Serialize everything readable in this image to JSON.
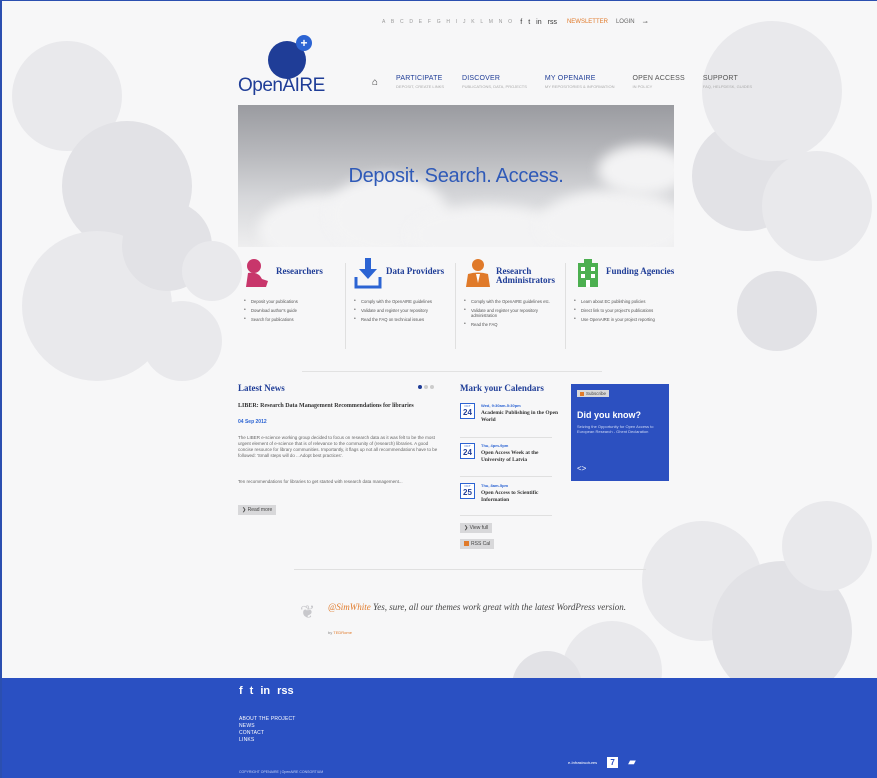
{
  "topbar": {
    "alphabet": "A B C D E F G H I J K L M N O",
    "social": [
      "f",
      "t",
      "in",
      "rss"
    ],
    "newsletter": "NEWSLETTER",
    "login": "LOGIN"
  },
  "logo": {
    "text": "OpenAIRE"
  },
  "nav": {
    "items": [
      {
        "label": "PARTICIPATE",
        "sub": "DEPOSIT, CREATE LINKS"
      },
      {
        "label": "DISCOVER",
        "sub": "PUBLICATIONS, DATA, PROJECTS"
      },
      {
        "label": "MY OPENAIRE",
        "sub": "MY REPOSITORIES & INFORMATION"
      },
      {
        "label": "OPEN ACCESS",
        "sub": "IN POLICY"
      },
      {
        "label": "SUPPORT",
        "sub": "FAQ, HELPDESK, GUIDES"
      }
    ]
  },
  "hero": {
    "title": "Deposit. Search. Access."
  },
  "audiences": [
    {
      "title": "Researchers",
      "color": "#c8366b",
      "items": [
        "Deposit your publications",
        "Download author's guide",
        "Search for publications"
      ]
    },
    {
      "title": "Data Providers",
      "color": "#2c64d3",
      "items": [
        "Comply with the OpenAIRE guidelines",
        "Validate and register your repository",
        "Read the FAQ on technical issues"
      ]
    },
    {
      "title": "Research Administrators",
      "color": "#e07a2a",
      "items": [
        "Comply with the OpenAIRE guidelines etc.",
        "Validate and register your repository administration",
        "Read the FAQ"
      ]
    },
    {
      "title": "Funding Agencies",
      "color": "#4caf50",
      "items": [
        "Learn about EC publishing policies",
        "Direct link to your project's publications",
        "Use OpenAIRE in your project reporting"
      ]
    }
  ],
  "news": {
    "heading": "Latest News",
    "headline": "LIBER: Research Data Management Recommendations for libraries",
    "date": "04 Sep 2012",
    "body": "The LIBER e-science working group decided to focus on research data as it was felt to be the most urgent element of e-science that is of relevance to the community of (research) libraries. A good concise resource for library communities. Importantly, it flags up not all recommendations have to be followed: 'Small steps will do ...Adopt best practices'.",
    "body2": "Ten recommendations for libraries to get started with research data management...",
    "read_more": "Read more"
  },
  "calendar": {
    "heading": "Mark your Calendars",
    "events": [
      {
        "month": "OCT",
        "day": "24",
        "when": "Wed, 9:30am-5:30pm",
        "title": "Academic Publishing in the Open World"
      },
      {
        "month": "OCT",
        "day": "24",
        "when": "Thu, 4pm-9pm",
        "title": "Open Access Week at the University of Latvia"
      },
      {
        "month": "OCT",
        "day": "25",
        "when": "Thu, 8am-5pm",
        "title": "Open Access to Scientific Information"
      }
    ],
    "view_full": "View full",
    "rss_cal": "RSS Cal"
  },
  "didyouknow": {
    "subscribe": "Subscribe",
    "title": "Did you know?",
    "text": "Seizing the Opportunity for Open Access to European Research - Ghent Declaration",
    "arrows": "<>"
  },
  "quote": {
    "handle": "@SimWhite",
    "text": " Yes, sure, all our themes work great with the latest WordPress version.",
    "by_prefix": "by",
    "by_name": "TEDRome"
  },
  "footer": {
    "social": [
      "f",
      "t",
      "in",
      "rss"
    ],
    "links": [
      "ABOUT THE PROJECT",
      "NEWS",
      "CONTACT",
      "LINKS"
    ],
    "copyright": "COPYRIGHT OPENAIRE | OpenAIRE CONSORTIUM",
    "infra": "e-Infrastructures",
    "seven": "7"
  }
}
